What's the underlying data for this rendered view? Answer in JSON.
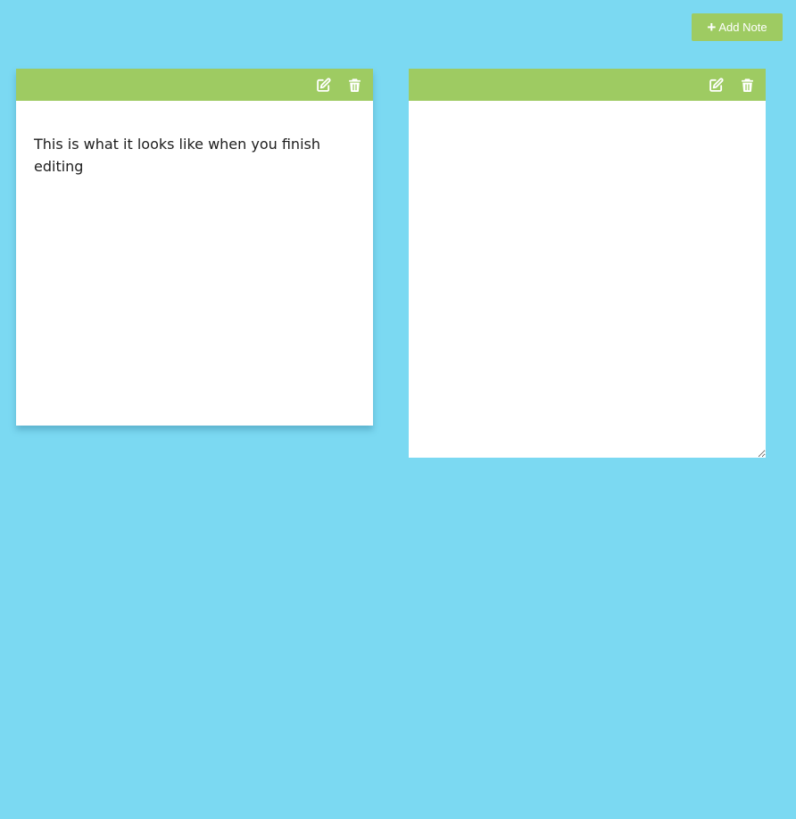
{
  "toolbar": {
    "add_note_label": "Add Note"
  },
  "notes": [
    {
      "mode": "view",
      "text": "This is what it looks like when you finish editing",
      "icons": [
        "edit-icon",
        "trash-icon"
      ]
    },
    {
      "mode": "edit",
      "text": "",
      "icons": [
        "edit-icon",
        "trash-icon"
      ]
    }
  ],
  "colors": {
    "background": "#7bd9f2",
    "accent": "#9ecb62",
    "note_body": "#ffffff",
    "text": "#1d1d1d"
  }
}
